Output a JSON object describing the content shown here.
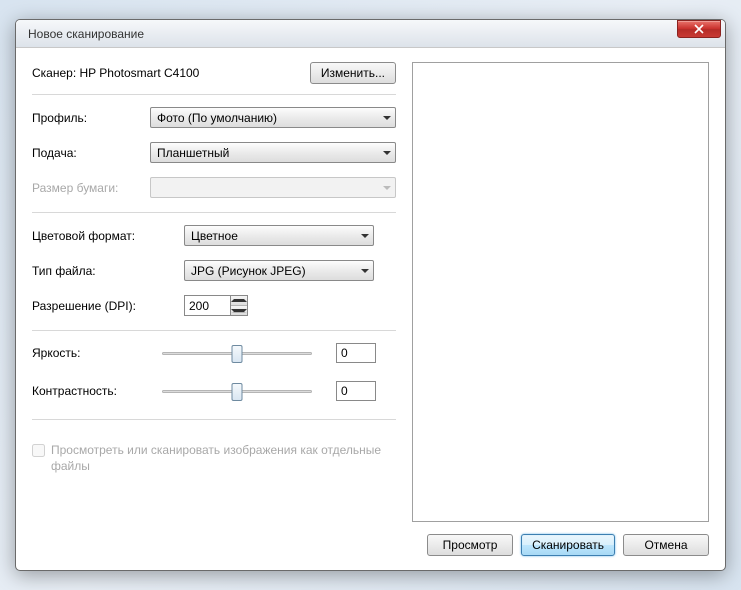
{
  "window": {
    "title": "Новое сканирование"
  },
  "scanner": {
    "label_prefix": "Сканер: ",
    "name": "HP Photosmart C4100",
    "change_btn": "Изменить..."
  },
  "fields": {
    "profile_label": "Профиль:",
    "profile_value": "Фото (По умолчанию)",
    "source_label": "Подача:",
    "source_value": "Планшетный",
    "papersize_label": "Размер бумаги:",
    "papersize_value": "",
    "colorformat_label": "Цветовой формат:",
    "colorformat_value": "Цветное",
    "filetype_label": "Тип файла:",
    "filetype_value": "JPG (Рисунок JPEG)",
    "dpi_label": "Разрешение (DPI):",
    "dpi_value": "200",
    "brightness_label": "Яркость:",
    "brightness_value": "0",
    "contrast_label": "Контрастность:",
    "contrast_value": "0"
  },
  "checkbox": {
    "label": "Просмотреть или сканировать изображения как отдельные файлы"
  },
  "buttons": {
    "preview": "Просмотр",
    "scan": "Сканировать",
    "cancel": "Отмена"
  }
}
